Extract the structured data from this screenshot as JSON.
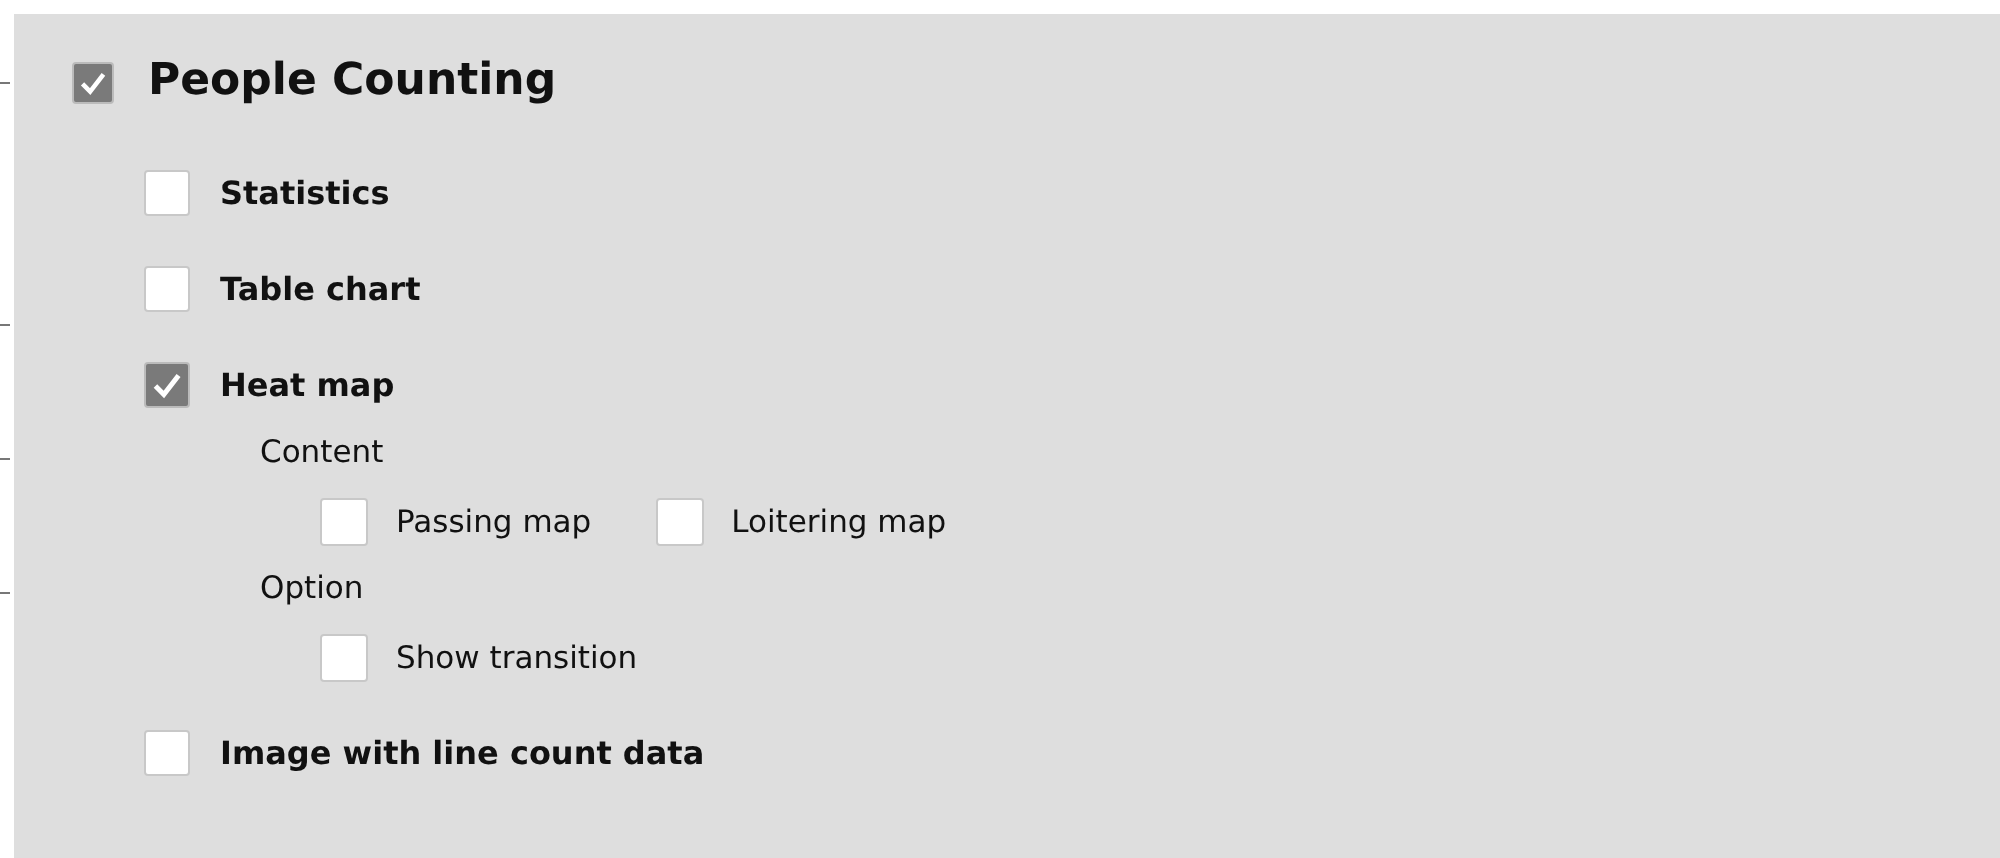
{
  "section": {
    "label": "People Counting",
    "checked": true
  },
  "items": [
    {
      "label": "Statistics",
      "checked": false
    },
    {
      "label": "Table chart",
      "checked": false
    },
    {
      "label": "Heat map",
      "checked": true,
      "groups": [
        {
          "label": "Content",
          "options": [
            {
              "label": "Passing map",
              "checked": false
            },
            {
              "label": "Loitering map",
              "checked": false
            }
          ]
        },
        {
          "label": "Option",
          "options": [
            {
              "label": "Show transition",
              "checked": false
            }
          ]
        }
      ]
    },
    {
      "label": "Image with line count data",
      "checked": false
    }
  ]
}
